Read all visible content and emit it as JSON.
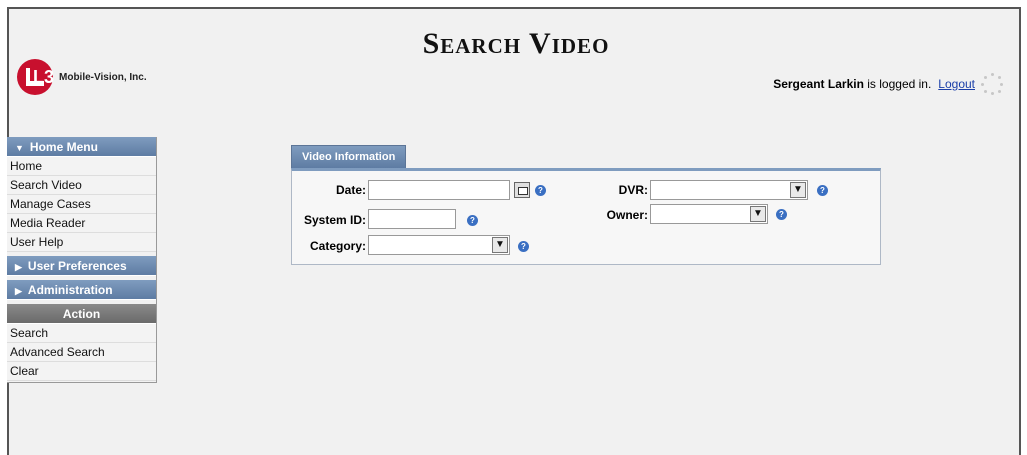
{
  "page": {
    "title": "Search Video"
  },
  "brand": {
    "logo_text": "L3",
    "company": "Mobile-Vision, Inc."
  },
  "session": {
    "user": "Sergeant Larkin",
    "status_text": "is logged in.",
    "logout_label": "Logout"
  },
  "sidebar": {
    "home_menu": {
      "label": "Home Menu",
      "items": [
        "Home",
        "Search Video",
        "Manage Cases",
        "Media Reader",
        "User Help"
      ]
    },
    "user_preferences": {
      "label": "User Preferences"
    },
    "administration": {
      "label": "Administration"
    },
    "action": {
      "label": "Action",
      "items": [
        "Search",
        "Advanced Search",
        "Clear"
      ]
    }
  },
  "video_info": {
    "tab_label": "Video Information",
    "fields": {
      "date": {
        "label": "Date:",
        "value": ""
      },
      "system_id": {
        "label": "System ID:",
        "value": ""
      },
      "category": {
        "label": "Category:",
        "value": ""
      },
      "dvr": {
        "label": "DVR:",
        "value": ""
      },
      "owner": {
        "label": "Owner:",
        "value": ""
      }
    },
    "help_glyph": "?"
  },
  "colors": {
    "menu_blue": "#6b88ae",
    "action_gray": "#787878",
    "logo_red": "#c8102e",
    "link_blue": "#1a3ea8"
  }
}
